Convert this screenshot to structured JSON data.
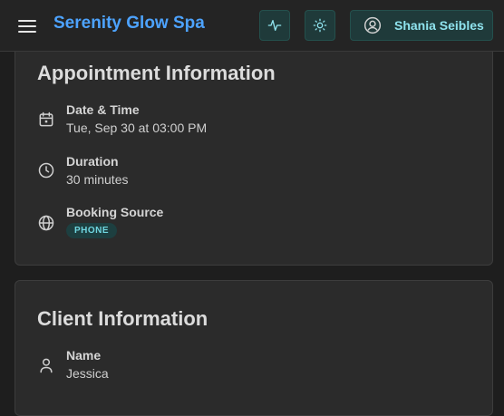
{
  "header": {
    "brand": "Serenity Glow Spa",
    "user_name": "Shania Seibles",
    "icons": {
      "menu": "hamburger-menu-icon",
      "activity": "activity-pulse-icon",
      "theme": "sun-icon",
      "user": "user-circle-icon"
    }
  },
  "appointment": {
    "title": "Appointment Information",
    "date_time": {
      "label": "Date & Time",
      "value": "Tue, Sep 30 at 03:00 PM",
      "icon": "calendar-icon"
    },
    "duration": {
      "label": "Duration",
      "value": "30 minutes",
      "icon": "clock-icon"
    },
    "booking_source": {
      "label": "Booking Source",
      "value": "PHONE",
      "icon": "globe-icon"
    }
  },
  "client": {
    "title": "Client Information",
    "name": {
      "label": "Name",
      "value": "Jessica",
      "icon": "user-icon"
    }
  },
  "colors": {
    "brand": "#4da3ff",
    "accent": "#8fe3ee",
    "badge_bg": "#1d3f40",
    "background": "#1e1e1e",
    "card": "#2b2b2b"
  }
}
